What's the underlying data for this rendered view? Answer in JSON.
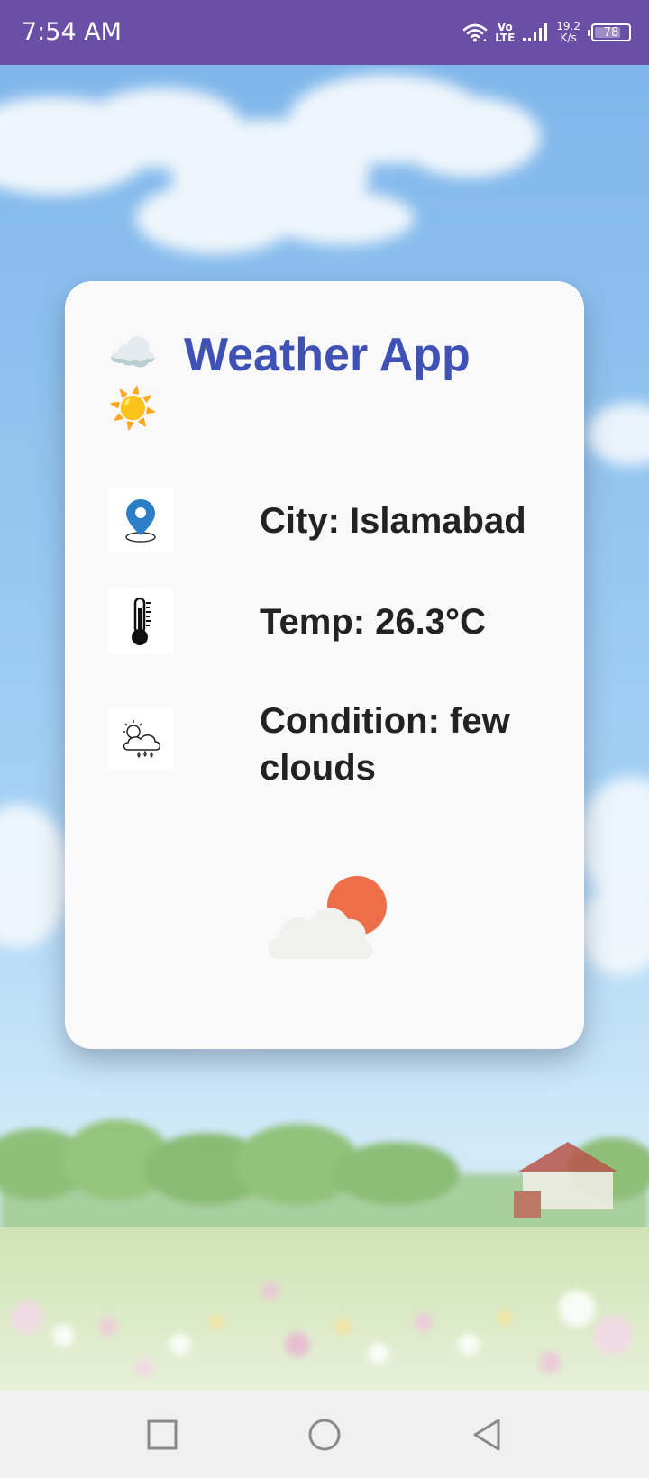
{
  "status_bar": {
    "time": "7:54 AM",
    "network_label_top": "Vo",
    "network_label_bottom": "LTE",
    "speed_value": "19.2",
    "speed_unit": "K/s",
    "battery_level": "78",
    "battery_fraction": 0.78
  },
  "card": {
    "title_emoji_cloud": "☁️",
    "title": "Weather App",
    "title_emoji_sun": "☀️",
    "city_label": "City: Islamabad",
    "temp_label": "Temp: 26.3°C",
    "condition_line1": "Condition: few",
    "condition_line2": "clouds"
  },
  "icons": {
    "city": "location-pin-icon",
    "temp": "thermometer-icon",
    "condition": "rain-cloud-icon",
    "illustration": "partly-cloudy-illustration"
  },
  "colors": {
    "status_bar": "#6a4fa6",
    "title": "#3f51b5",
    "sun": "#ee6e4a",
    "pin": "#2c7fc6"
  }
}
